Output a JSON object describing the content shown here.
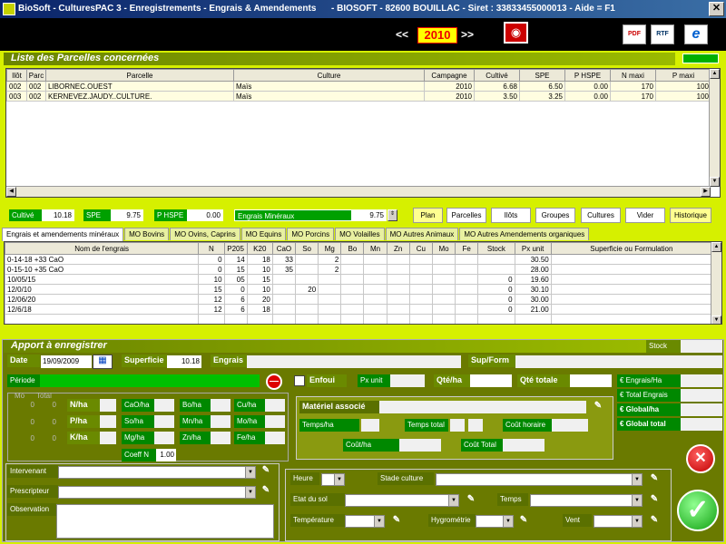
{
  "app": {
    "title": "BioSoft - CulturesPAC 3 - Enregistrements - Engrais & Amendements      - BIOSOFT - 82600 BOUILLAC - Siret : 33833455000013 - Aide = F1"
  },
  "year": {
    "prev": "<<",
    "value": "2010",
    "next": ">>"
  },
  "toolbar": {
    "pdf": "PDF",
    "rtf": "RTF",
    "ie": "e"
  },
  "parcelles": {
    "title": "Liste des Parcelles concernées",
    "columns": [
      "Ilôt",
      "Parc",
      "Parcelle",
      "Culture",
      "Campagne",
      "Cultivé",
      "SPE",
      "P HSPE",
      "N maxi",
      "P maxi"
    ],
    "rows": [
      [
        "002",
        "002",
        "LIBORNEC.OUEST",
        "Maïs",
        "2010",
        "6.68",
        "6.50",
        "0.00",
        "170",
        "100"
      ],
      [
        "003",
        "002",
        "KERNEVEZ.JAUDY..CULTURE.",
        "Maïs",
        "2010",
        "3.50",
        "3.25",
        "0.00",
        "170",
        "100"
      ]
    ]
  },
  "totals": {
    "cultive_label": "Cultivé",
    "cultive": "10.18",
    "spe_label": "SPE",
    "spe": "9.75",
    "phspe_label": "P HSPE",
    "phspe": "0.00",
    "engrais_label": "Engrais Minéraux",
    "engrais": "9.75"
  },
  "buttons": {
    "plan": "Plan",
    "parcelles": "Parcelles",
    "ilots": "Ilôts",
    "groupes": "Groupes",
    "cultures": "Cultures",
    "vider": "Vider",
    "historique": "Historique"
  },
  "tabs": [
    "Engrais et amendements minéraux",
    "MO Bovins",
    "MO Ovins, Caprins",
    "MO Equins",
    "MO Porcins",
    "MO Volailles",
    "MO Autres Animaux",
    "MO Autres Amendements organiques"
  ],
  "engrais": {
    "columns": [
      "Nom de l'engrais",
      "N",
      "P205",
      "K20",
      "CaO",
      "So",
      "Mg",
      "Bo",
      "Mn",
      "Zn",
      "Cu",
      "Mo",
      "Fe",
      "Stock",
      "Px unit",
      "Superficie ou Formulation"
    ],
    "rows": [
      [
        "0-14-18 +33 CaO",
        "0",
        "14",
        "18",
        "33",
        "",
        "2",
        "",
        "",
        "",
        "",
        "",
        "",
        "",
        "30.50",
        ""
      ],
      [
        "0-15-10 +35 CaO",
        "0",
        "15",
        "10",
        "35",
        "",
        "2",
        "",
        "",
        "",
        "",
        "",
        "",
        "",
        "28.00",
        ""
      ],
      [
        "10/05/15",
        "10",
        "05",
        "15",
        "",
        "",
        "",
        "",
        "",
        "",
        "",
        "",
        "",
        "0",
        "19.60",
        ""
      ],
      [
        "12/0/10",
        "15",
        "0",
        "10",
        "",
        "20",
        "",
        "",
        "",
        "",
        "",
        "",
        "",
        "0",
        "30.10",
        ""
      ],
      [
        "12/06/20",
        "12",
        "6",
        "20",
        "",
        "",
        "",
        "",
        "",
        "",
        "",
        "",
        "",
        "0",
        "30.00",
        ""
      ],
      [
        "12/6/18",
        "12",
        "6",
        "18",
        "",
        "",
        "",
        "",
        "",
        "",
        "",
        "",
        "",
        "0",
        "21.00",
        ""
      ]
    ]
  },
  "apport": {
    "title": "Apport à enregistrer",
    "stock": "Stock",
    "date_label": "Date",
    "date": "19/09/2009",
    "superficie_label": "Superficie",
    "superficie": "10.18",
    "engrais_label": "Engrais",
    "supform_label": "Sup/Form",
    "periode_label": "Période",
    "enfoui_label": "Enfoui",
    "pxunit_label": "Px unit",
    "qteha_label": "Qté/ha",
    "qtetotale_label": "Qté totale",
    "eur_engrais_ha": "€ Engrais/Ha",
    "eur_total_engrais": "€ Total Engrais",
    "eur_global_ha": "€ Global/ha",
    "eur_global_total": "€ Global total",
    "mo_label": "Mo",
    "total_label": "Total",
    "mo_vals": [
      "0",
      "0",
      "0"
    ],
    "total_vals": [
      "0",
      "0",
      "0"
    ],
    "n_ha": "N/ha",
    "p_ha": "P/ha",
    "k_ha": "K/ha",
    "cao_ha": "CaO/ha",
    "so_ha": "So/ha",
    "mg_ha": "Mg/ha",
    "bo_ha": "Bo/ha",
    "mn_ha": "Mn/ha",
    "zn_ha": "Zn/ha",
    "cu_ha": "Cu/ha",
    "mo_ha": "Mo/ha",
    "fe_ha": "Fe/ha",
    "coeff_label": "Coeff N",
    "coeff": "1.00",
    "materiel_label": "Matériel associé",
    "temps_ha": "Temps/ha",
    "temps_total": "Temps total",
    "cout_horaire": "Coût horaire",
    "cout_ha": "Coût/ha",
    "cout_total": "Coût Total",
    "intervenant": "Intervenant",
    "prescripteur": "Prescripteur",
    "observation": "Observation",
    "heure": "Heure",
    "stade": "Stade culture",
    "etat_sol": "Etat du sol",
    "temps": "Temps",
    "temperature": "Température",
    "hygrometrie": "Hygrométrie",
    "vent": "Vent"
  }
}
